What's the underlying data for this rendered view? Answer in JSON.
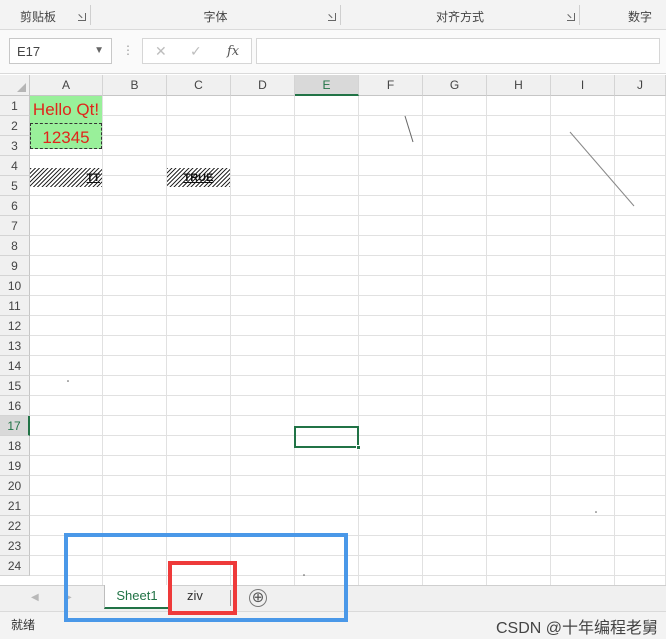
{
  "ribbon": {
    "groups": [
      {
        "label": "剪贴板"
      },
      {
        "label": "字体"
      },
      {
        "label": "对齐方式"
      },
      {
        "label": "数字"
      }
    ]
  },
  "formula_bar": {
    "name_box": "E17",
    "cancel_icon": "✕",
    "enter_icon": "✓",
    "fx_icon": "fx",
    "formula": ""
  },
  "grid": {
    "columns": [
      "A",
      "B",
      "C",
      "D",
      "E",
      "F",
      "G",
      "H",
      "I",
      "J"
    ],
    "rows": [
      "1",
      "2",
      "3",
      "4",
      "5",
      "6",
      "7",
      "8",
      "9",
      "10",
      "11",
      "12",
      "13",
      "14",
      "15",
      "16",
      "17",
      "18",
      "19",
      "20",
      "21",
      "22",
      "23",
      "24"
    ],
    "active_cell": "E17",
    "cells": {
      "A1": "Hello Qt!",
      "A2": "12345",
      "A4": "TT",
      "C4": "TRUE"
    },
    "colors": {
      "fill_green": "#99f09a",
      "text_red": "#e0261b",
      "selection": "#217346"
    }
  },
  "sheet_tabs": {
    "tabs": [
      {
        "label": "Sheet1",
        "active": true
      },
      {
        "label": "ziv",
        "active": false
      }
    ],
    "add_icon": "⊕"
  },
  "status_bar": {
    "status": "就绪",
    "watermark": "CSDN @十年编程老舅"
  },
  "annotations": {
    "blue_box_color": "#4a98e8",
    "red_box_color": "#ee3a3a"
  }
}
